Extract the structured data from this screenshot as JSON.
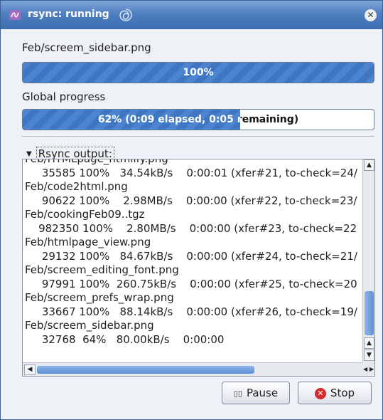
{
  "window": {
    "title": "rsync: running",
    "close_glyph": "✕"
  },
  "file_progress": {
    "filename": "Feb/screem_sidebar.png",
    "percent": 100,
    "text": "100%"
  },
  "global_progress": {
    "label": "Global progress",
    "percent": 62,
    "text": "62% (0:09 elapsed, 0:05 remaining)"
  },
  "output": {
    "expander_label": "Rsync output:",
    "lines": [
      "Feb/HTMLpage_htmlify.png",
      "     35585 100%   34.54kB/s    0:00:01 (xfer#21, to-check=24/",
      "Feb/code2html.png",
      "     90622 100%    2.98MB/s    0:00:00 (xfer#22, to-check=23/",
      "Feb/cookingFeb09..tgz",
      "    982350 100%    2.80MB/s    0:00:00 (xfer#23, to-check=22",
      "Feb/htmlpage_view.png",
      "     29132 100%   84.67kB/s    0:00:00 (xfer#24, to-check=21/",
      "Feb/screem_editing_font.png",
      "     97991 100%  260.75kB/s    0:00:00 (xfer#25, to-check=20",
      "Feb/screem_prefs_wrap.png",
      "     33667 100%   88.14kB/s    0:00:00 (xfer#26, to-check=19/",
      "Feb/screem_sidebar.png",
      "     32768  64%   80.00kB/s    0:00:00"
    ]
  },
  "buttons": {
    "pause_label": "Pause",
    "stop_label": "Stop"
  },
  "icons": {
    "app": "rsync-app-icon",
    "title_swirl": "swirl-icon",
    "close": "close-icon",
    "pause": "pause-icon",
    "stop": "stop-icon",
    "expander": "triangle-down-icon",
    "scroll_up": "arrow-up-icon",
    "scroll_down": "arrow-down-icon",
    "scroll_left": "arrow-left-icon",
    "scroll_right": "arrow-right-icon"
  },
  "colors": {
    "titlebar": "#4f7fc0",
    "progress_fill": "#4d84cf",
    "stop_red": "#d62a2a"
  }
}
